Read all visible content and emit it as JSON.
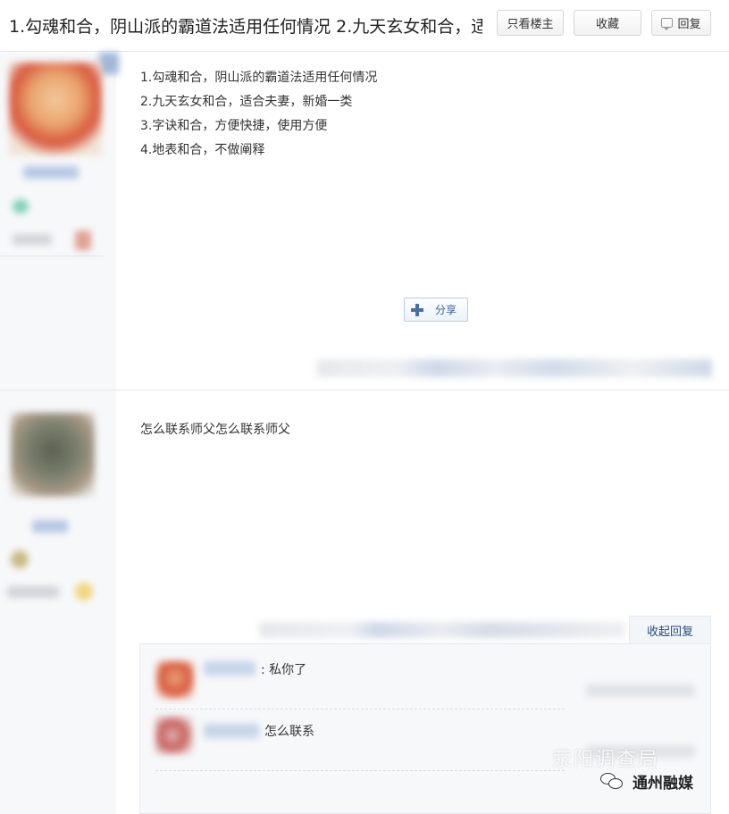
{
  "header": {
    "title": "1.勾魂和合，阴山派的霸道法适用任何情况 2.九天玄女和合，适",
    "buttons": {
      "only_op": "只看楼主",
      "favorite": "收藏",
      "reply": "回复"
    }
  },
  "posts": [
    {
      "lines": [
        "1.勾魂和合，阴山派的霸道法适用任何情况",
        "2.九天玄女和合，适合夫妻，新婚一类",
        "3.字诀和合，方便快捷，使用方便",
        "4.地表和合，不做阐释"
      ],
      "share_label": "分享"
    },
    {
      "text": "怎么联系师父怎么联系师父",
      "collapse_label": "收起回复",
      "replies": [
        {
          "text": ": 私你了"
        },
        {
          "text": "怎么联系"
        }
      ]
    }
  ],
  "watermark": {
    "faded": "荥阳调查局",
    "main": "通州融媒"
  },
  "colors": {
    "link": "#2a4c80",
    "sidebar_bg": "#f7f8fa",
    "border": "#e3e3e3"
  }
}
